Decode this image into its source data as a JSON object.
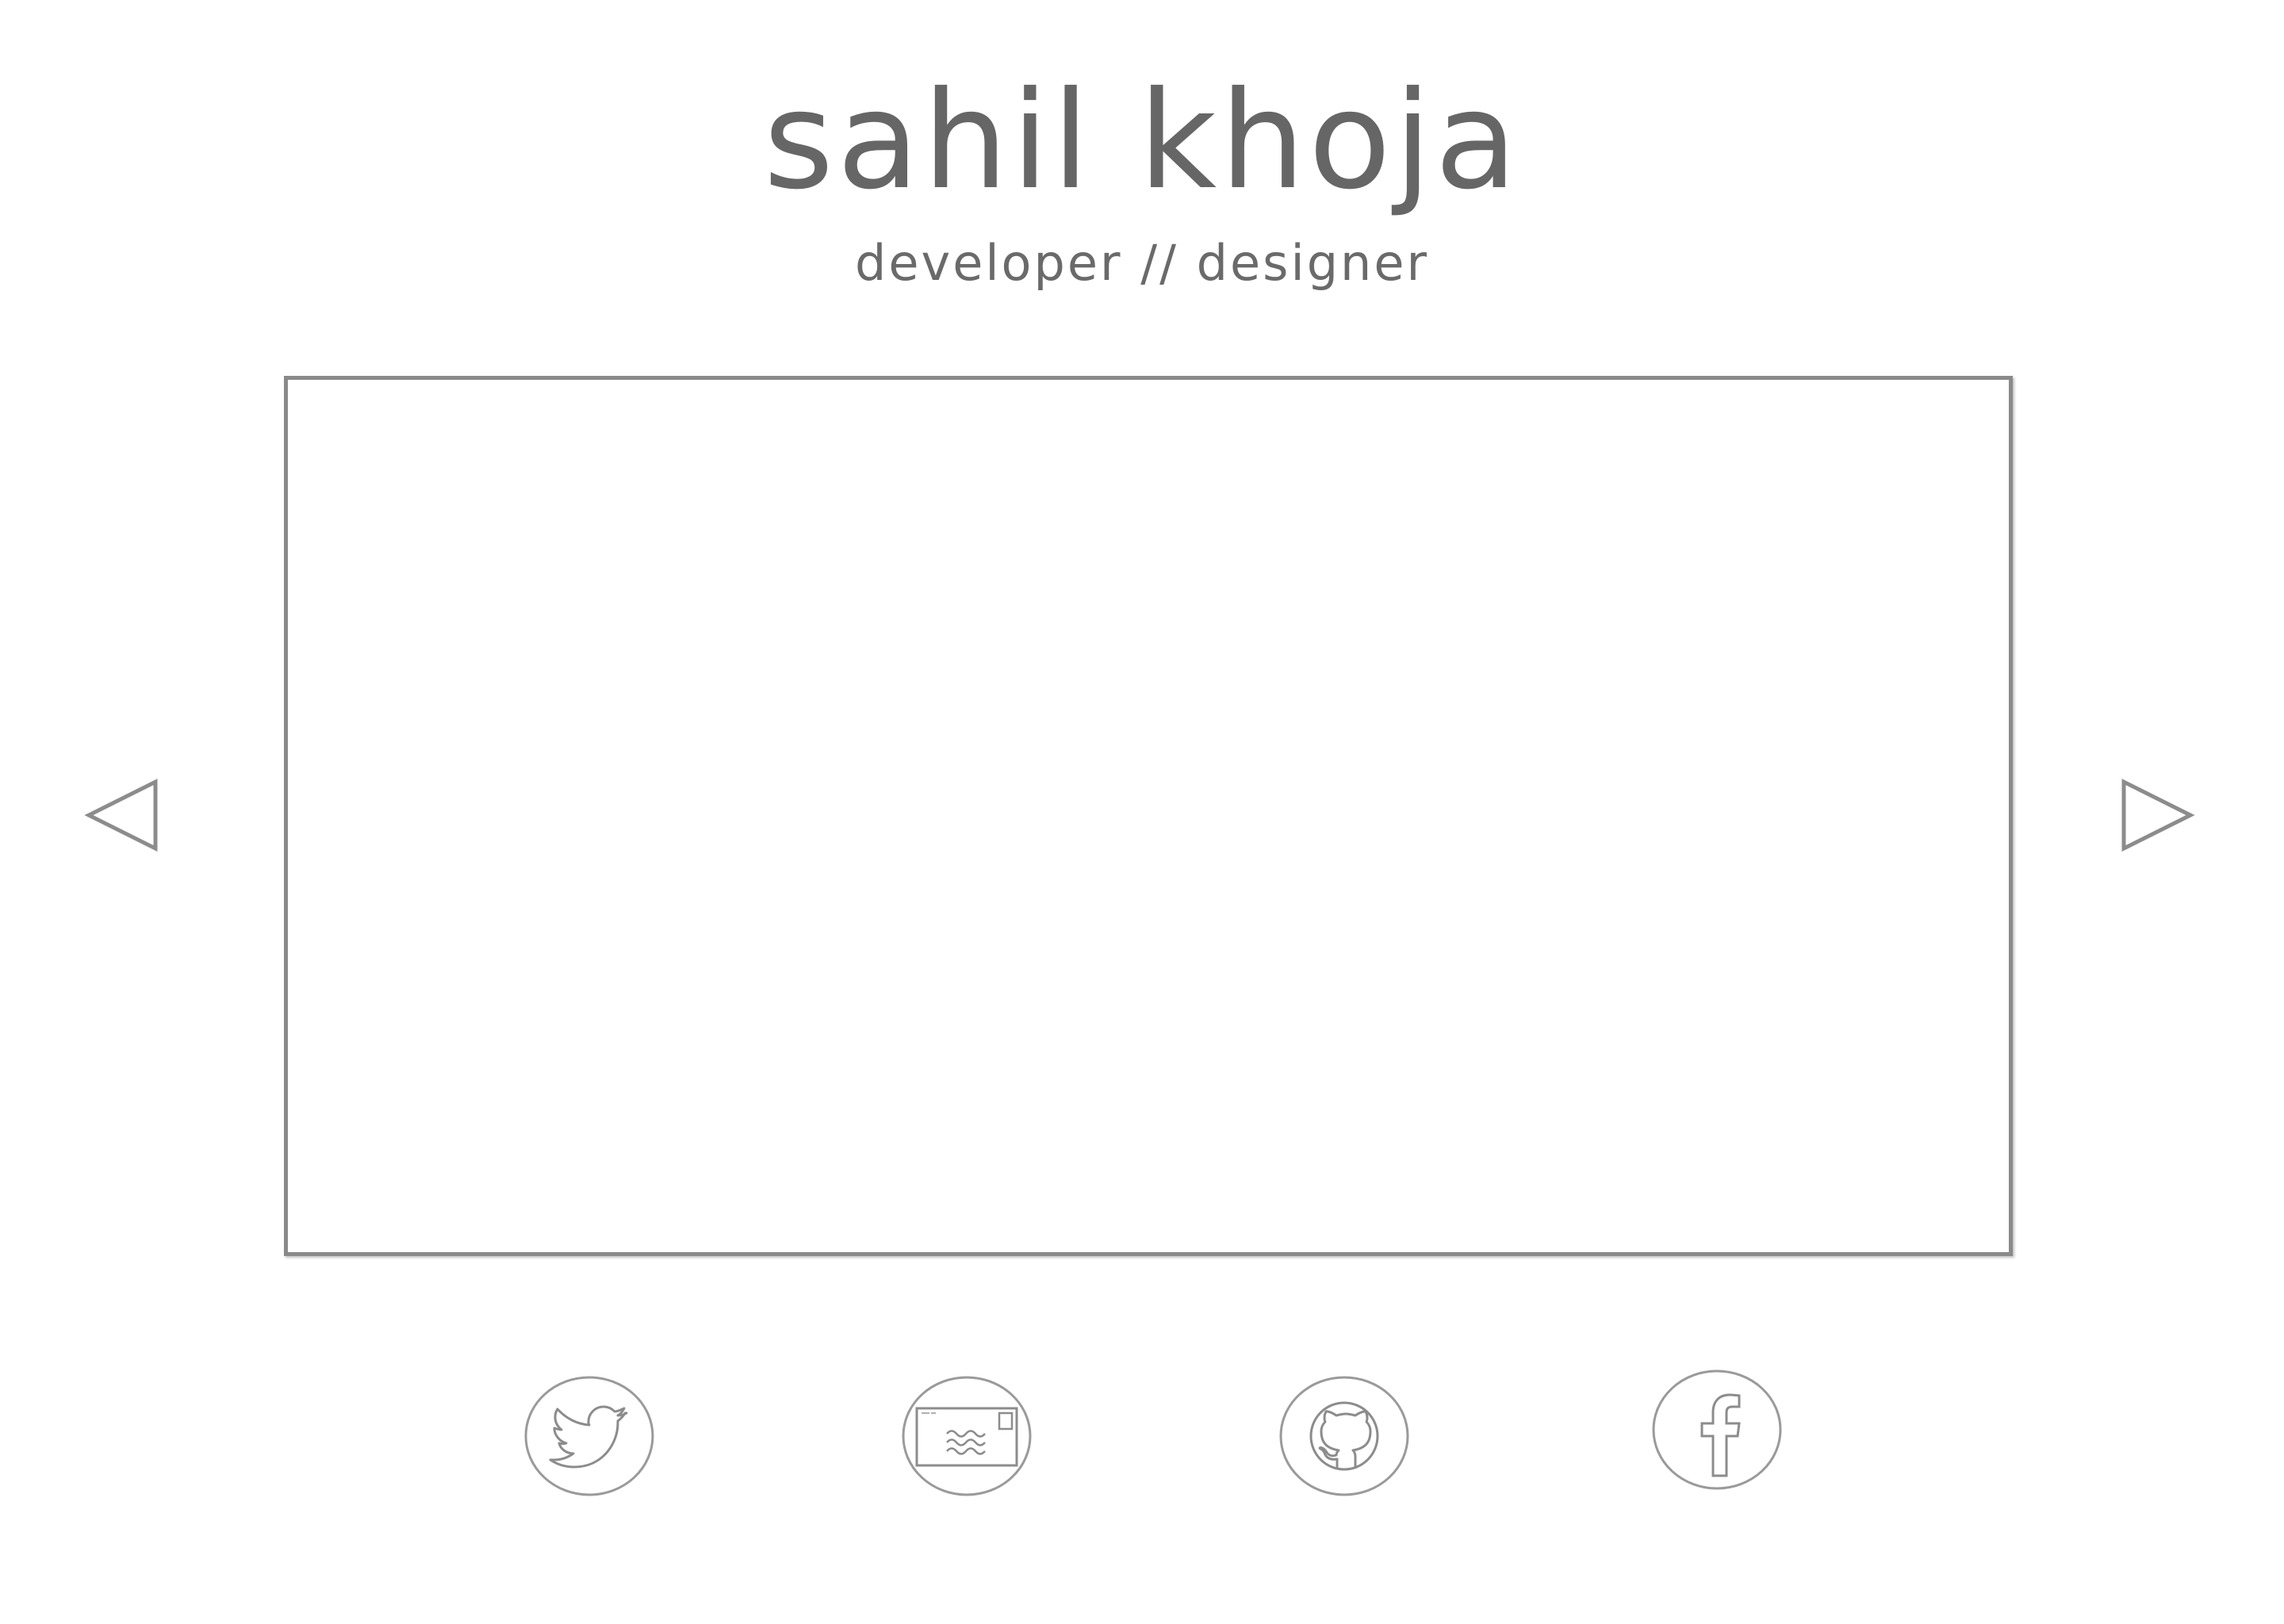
{
  "header": {
    "name": "sahil khoja",
    "tagline": "developer // designer"
  },
  "carousel": {
    "prev_icon": "triangle-left-outline",
    "next_icon": "triangle-right-outline"
  },
  "social_links": [
    {
      "id": "twitter",
      "icon": "twitter-bird-icon"
    },
    {
      "id": "email",
      "icon": "envelope-icon"
    },
    {
      "id": "github",
      "icon": "github-octocat-icon"
    },
    {
      "id": "facebook",
      "icon": "facebook-f-icon"
    }
  ],
  "colors": {
    "text": "#666666",
    "stroke": "#8a8a8a",
    "background": "#ffffff"
  }
}
